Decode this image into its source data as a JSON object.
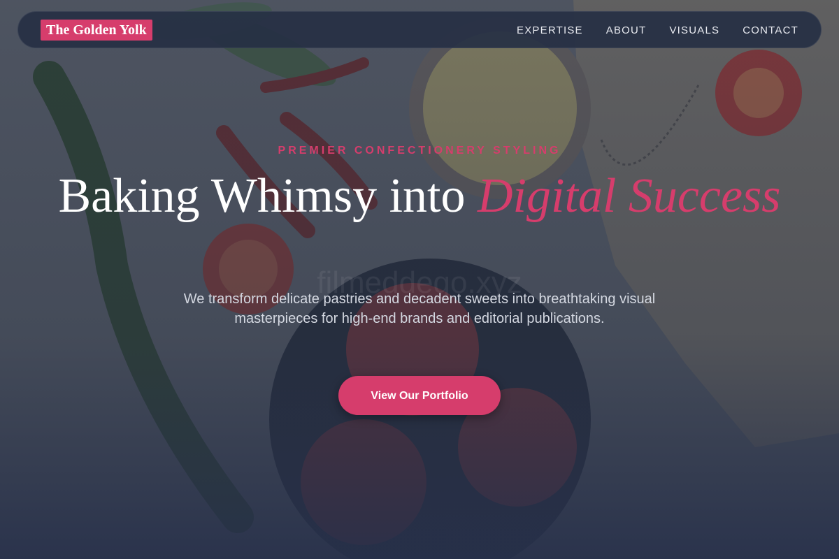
{
  "brand": {
    "logo_text": "The Golden Yolk"
  },
  "nav": {
    "items": [
      {
        "label": "EXPERTISE"
      },
      {
        "label": "ABOUT"
      },
      {
        "label": "VISUALS"
      },
      {
        "label": "CONTACT"
      }
    ]
  },
  "hero": {
    "eyebrow": "PREMIER CONFECTIONERY STYLING",
    "headline_plain": "Baking Whimsy into ",
    "headline_accent": "Digital Success",
    "lead": "We transform delicate pastries and decadent sweets into breathtaking visual masterpieces for high-end brands and editorial publications.",
    "cta_label": "View Our Portfolio",
    "watermark": "filmeddego.xyz"
  },
  "colors": {
    "accent": "#d63d6c",
    "nav_bg": "#263044",
    "overlay": "#2a3142"
  }
}
